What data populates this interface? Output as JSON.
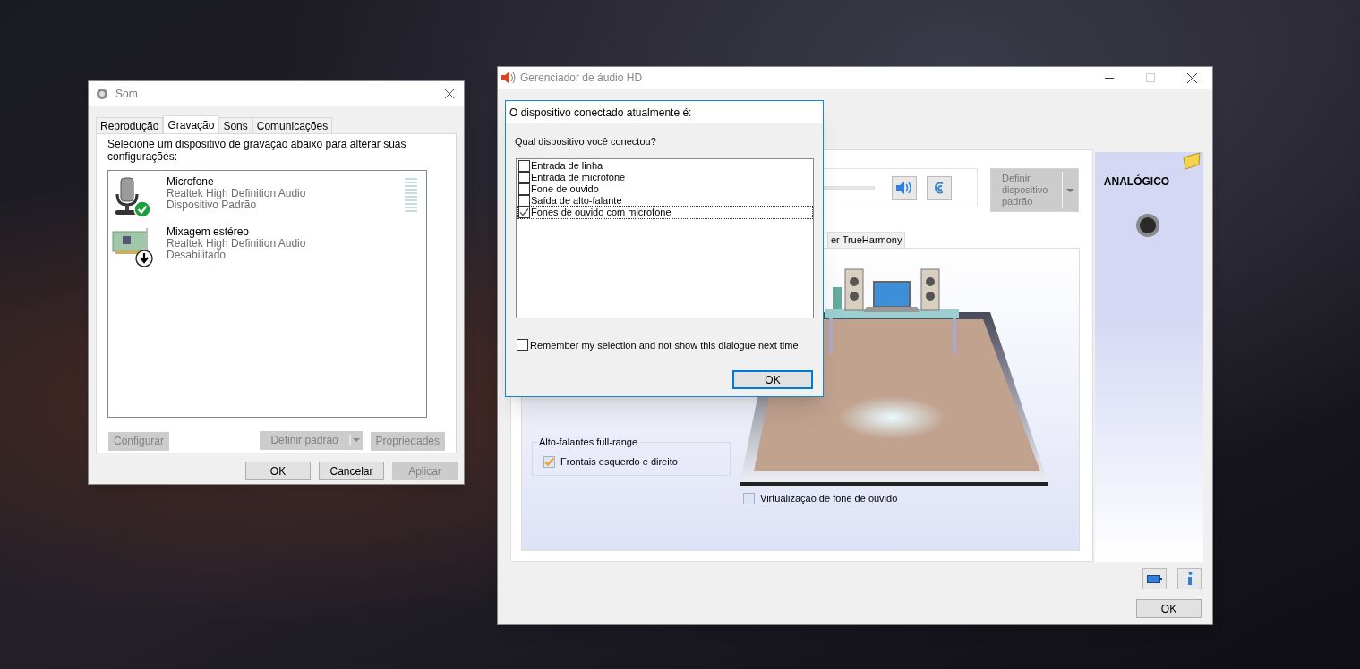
{
  "som_window": {
    "title": "Som",
    "tabs": [
      {
        "label": "Reprodução",
        "selected": false
      },
      {
        "label": "Gravação",
        "selected": true
      },
      {
        "label": "Sons",
        "selected": false
      },
      {
        "label": "Comunicações",
        "selected": false
      }
    ],
    "instruction": "Selecione um dispositivo de gravação abaixo para alterar suas configurações:",
    "devices": [
      {
        "kind": "microphone",
        "name": "Microfone",
        "driver": "Realtek High Definition Audio",
        "status": "Dispositivo Padrão",
        "is_default": true
      },
      {
        "kind": "mixer",
        "name": "Mixagem estéreo",
        "driver": "Realtek High Definition Audio",
        "status": "Desabilitado",
        "is_default": false
      }
    ],
    "device_buttons": [
      {
        "label": "Configurar",
        "disabled": true,
        "split": false
      },
      {
        "label": "Definir padrão",
        "disabled": true,
        "split": true
      },
      {
        "label": "Propriedades",
        "disabled": true,
        "split": false
      }
    ],
    "footer_buttons": [
      {
        "label": "OK",
        "disabled": false
      },
      {
        "label": "Cancelar",
        "disabled": false
      },
      {
        "label": "Aplicar",
        "disabled": true
      }
    ]
  },
  "hd_window": {
    "title": "Gerenciador de áudio HD",
    "default_device_button": {
      "label": "Definir dispositivo padrão",
      "disabled": true
    },
    "tab_label": "er TrueHarmony",
    "speaker_group": {
      "title": "Alto-falantes full-range",
      "options": [
        {
          "label": "Frontais esquerdo e direito",
          "checked": true
        }
      ]
    },
    "headphone_virtualization": {
      "label": "Virtualização de fone de ouvido",
      "checked": false
    },
    "connector_panel": {
      "label": "ANALÓGICO"
    },
    "ok_button": "OK"
  },
  "dialog": {
    "title": "O dispositivo conectado atualmente é:",
    "question": "Qual dispositivo você conectou?",
    "options": [
      {
        "label": "Entrada de linha",
        "checked": false,
        "focused": false
      },
      {
        "label": "Entrada de microfone",
        "checked": false,
        "focused": false
      },
      {
        "label": "Fone de ouvido",
        "checked": false,
        "focused": false
      },
      {
        "label": "Saída de alto-falante",
        "checked": false,
        "focused": false
      },
      {
        "label": "Fones de ouvido com microfone",
        "checked": true,
        "focused": true
      }
    ],
    "remember": {
      "label": "Remember my selection and not show this dialogue next time",
      "checked": false
    },
    "ok_button": "OK"
  }
}
